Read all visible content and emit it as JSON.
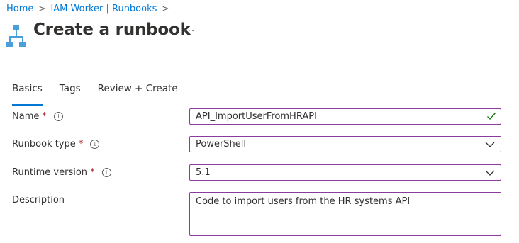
{
  "breadcrumb": {
    "items": [
      "Home",
      "IAM-Worker | Runbooks"
    ],
    "separator": ">"
  },
  "header": {
    "title": "Create a runbook",
    "more": "···",
    "icon": "runbook-hierarchy-icon"
  },
  "tabs": [
    {
      "label": "Basics",
      "active": true
    },
    {
      "label": "Tags",
      "active": false
    },
    {
      "label": "Review + Create",
      "active": false
    }
  ],
  "form": {
    "name": {
      "label": "Name",
      "required": true,
      "value": "API_ImportUserFromHRAPI",
      "valid": true
    },
    "runbook_type": {
      "label": "Runbook type",
      "required": true,
      "value": "PowerShell"
    },
    "runtime_version": {
      "label": "Runtime version",
      "required": true,
      "value": "5.1"
    },
    "description": {
      "label": "Description",
      "required": false,
      "value": "Code to import users from the HR systems API"
    }
  },
  "required_marker": "*",
  "info_glyph": "i",
  "colors": {
    "link": "#0078d4",
    "field_border": "#8a3b9e",
    "required": "#a4262c",
    "valid_check": "#107c10",
    "icon": "#4a9fd8"
  }
}
